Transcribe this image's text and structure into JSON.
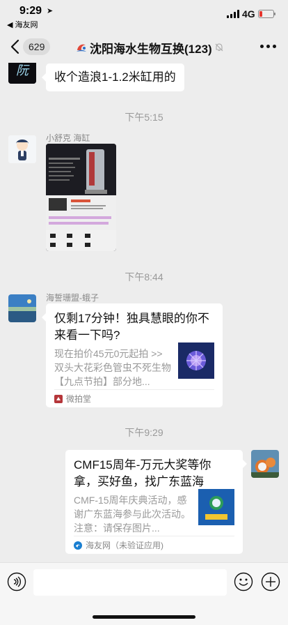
{
  "status_bar": {
    "time": "9:29",
    "back_app": "◀ 海友网",
    "network": "4G"
  },
  "header": {
    "unread_count": "629",
    "title": "沈阳海水生物互换(123)"
  },
  "messages": {
    "m1_text": "收个造浪1-1.2米缸用的",
    "time_1": "下午5:15",
    "m2_sender": "小舒克 海缸",
    "time_2": "下午8:44",
    "m3_sender": "海誓珊盟-蛾子",
    "m3_card": {
      "title": "仅剩17分钟！独具慧眼的你不来看一下吗?",
      "desc": "现在拍价45元0元起拍 >> 双头大花彩色管虫不死生物【九点节拍】部分地...",
      "source": "微拍堂"
    },
    "time_3": "下午9:29",
    "m4_card": {
      "title": "CMF15周年-万元大奖等你拿，买好鱼，找广东蓝海",
      "desc": "CMF-15周年庆典活动，感谢广东蓝海参与此次活动。注意：请保存图片...",
      "source": "海友网（未验证应用)"
    }
  },
  "colors": {
    "background": "#ededed",
    "bubble": "#ffffff",
    "battery_low": "#e5342d",
    "weipaitang": "#b5363a",
    "haiyou": "#1a7fd1"
  }
}
